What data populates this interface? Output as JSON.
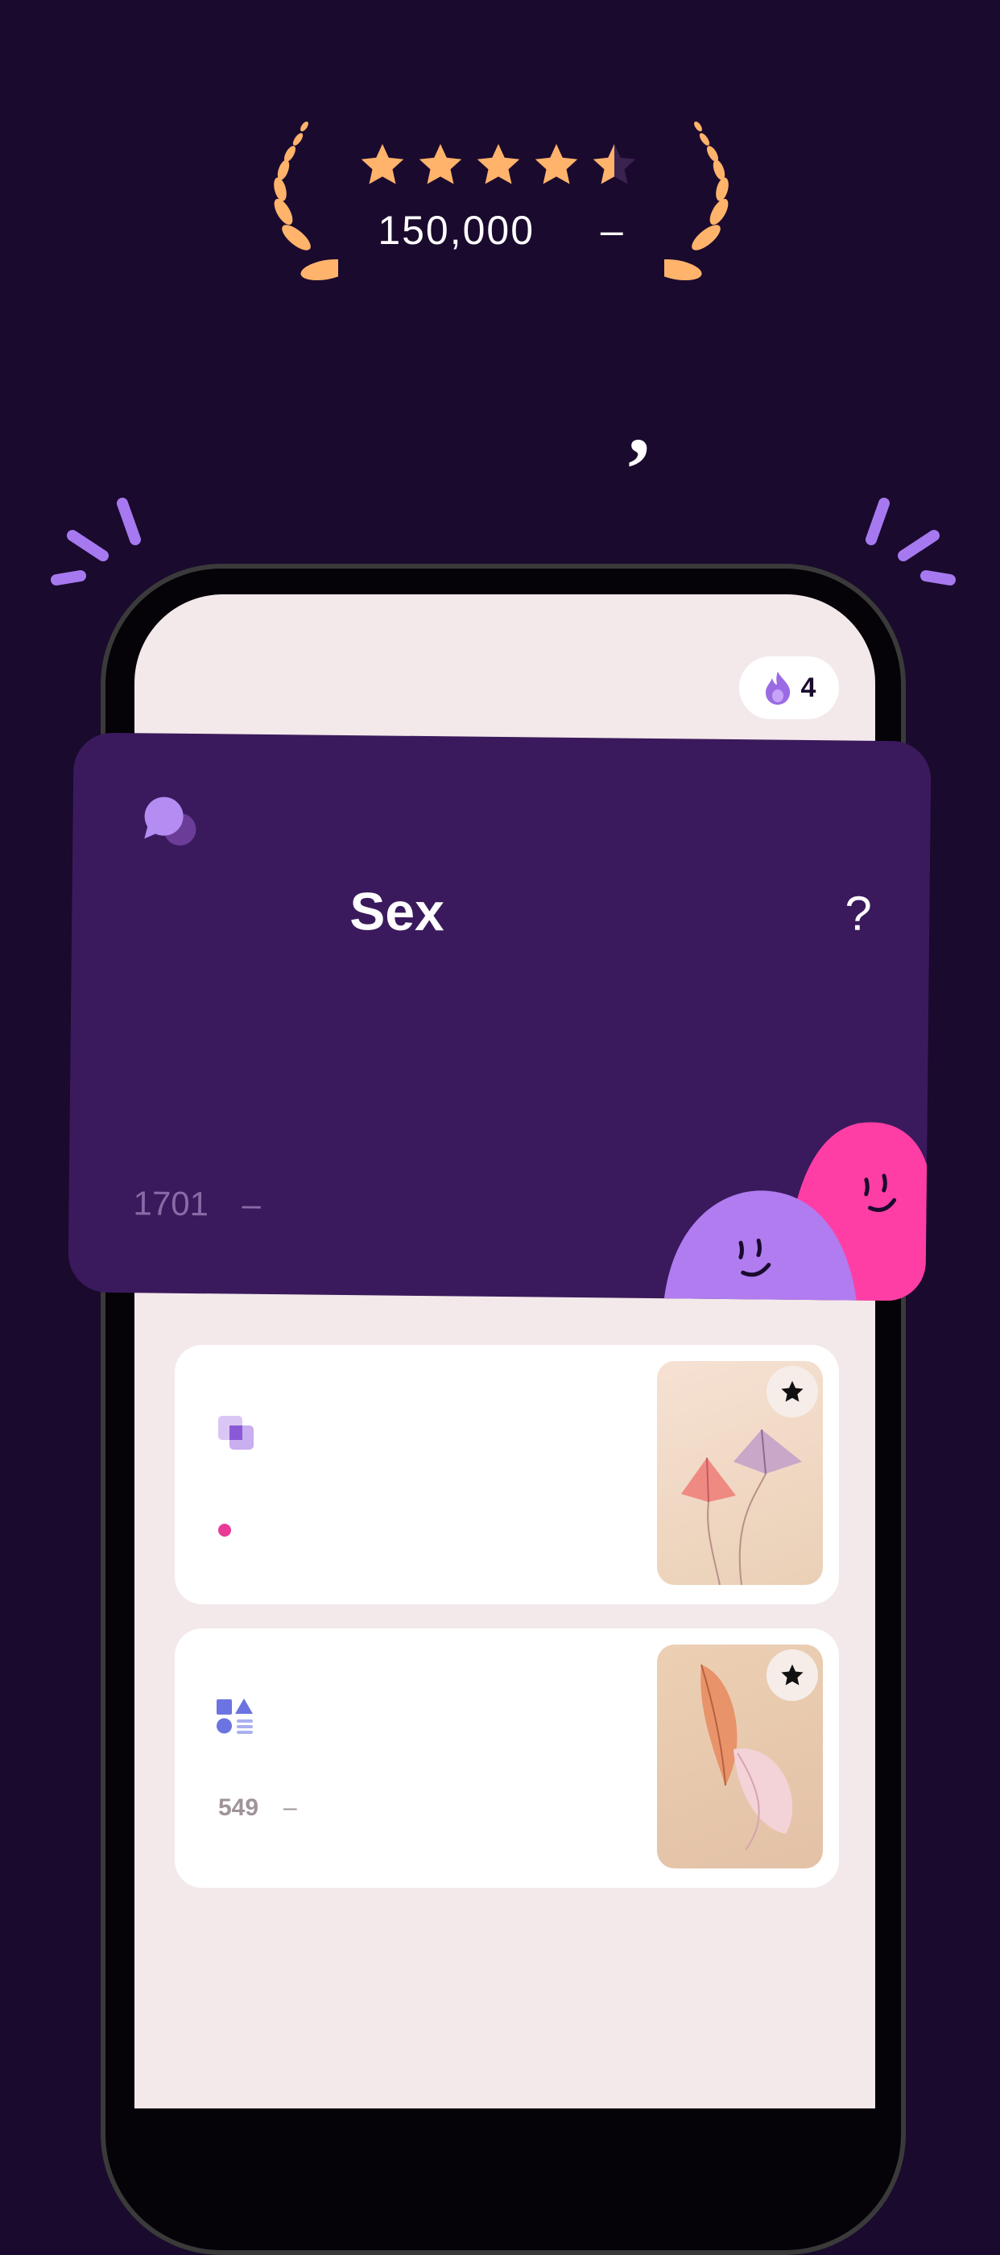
{
  "rating": {
    "stars": 4.5,
    "max_stars": 5,
    "count_text": "150,000",
    "dash": "–"
  },
  "headline": {
    "comma": ","
  },
  "counter": {
    "icon": "flame-icon",
    "value": "4"
  },
  "topic_card": {
    "icon": "chat-bubbles-icon",
    "title": "Sex",
    "question_mark": "?",
    "count": "1701",
    "dash": "–"
  },
  "content_cards": [
    {
      "icon": "layers-icon",
      "meta_count": "",
      "dash": "",
      "image": "kites-illustration",
      "action_icon": "star-icon"
    },
    {
      "icon": "shapes-icon",
      "meta_count": "549",
      "dash": "–",
      "image": "feathers-illustration",
      "action_icon": "star-icon"
    }
  ],
  "colors": {
    "background": "#1a0a2e",
    "card_purple": "#3a1a5c",
    "accent_purple": "#b07cf0",
    "accent_pink": "#ff3ea5",
    "gold": "#ffb36b"
  }
}
